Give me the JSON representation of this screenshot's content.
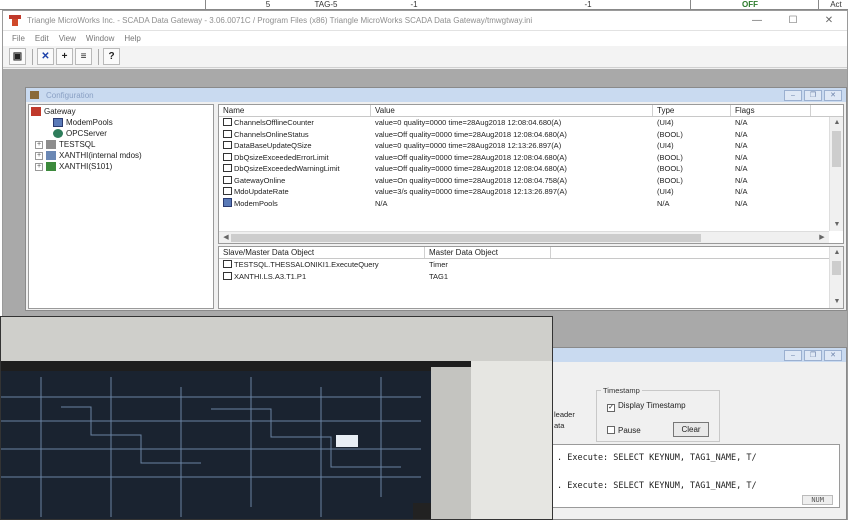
{
  "background_table": {
    "cells": [
      "5",
      "TAG-5",
      "-1",
      "-1",
      "OFF",
      "Act"
    ]
  },
  "window": {
    "title": "Triangle MicroWorks Inc. - SCADA Data Gateway - 3.06.0071C / Program Files (x86) Triangle MicroWorks SCADA Data Gateway/tmwgtway.ini",
    "controls": {
      "minimize": "—",
      "maximize": "☐",
      "close": "✕"
    }
  },
  "menu": [
    "File",
    "Edit",
    "View",
    "Window",
    "Help"
  ],
  "toolbar": {
    "buttons": [
      {
        "name": "save-icon",
        "glyph": "▣"
      },
      {
        "name": "delete-icon",
        "glyph": "✕"
      },
      {
        "name": "add-icon",
        "glyph": "+"
      },
      {
        "name": "properties-icon",
        "glyph": "≡"
      },
      {
        "name": "help-icon",
        "glyph": "?"
      }
    ]
  },
  "config_window": {
    "title": "Configuration",
    "tree": [
      {
        "label": "Gateway",
        "level": 0,
        "icon": "gateway-icon",
        "expander": ""
      },
      {
        "label": "ModemPools",
        "level": 1,
        "icon": "modem-pools-icon",
        "expander": ""
      },
      {
        "label": "OPCServer",
        "level": 1,
        "icon": "opc-server-icon",
        "expander": ""
      },
      {
        "label": "TESTSQL",
        "level": 1,
        "icon": "sql-icon",
        "expander": "+"
      },
      {
        "label": "XANTHI(internal mdos)",
        "level": 1,
        "icon": "channel-icon",
        "expander": "+"
      },
      {
        "label": "XANTHI(S101)",
        "level": 1,
        "icon": "device-icon",
        "expander": "+"
      }
    ],
    "columns": [
      "Name",
      "Value",
      "Type",
      "Flags"
    ],
    "rows": [
      {
        "name": "ChannelsOfflineCounter",
        "value": "value=0     quality=0000 time=28Aug2018 12:08:04.680(A)",
        "type": "(UI4)",
        "flags": "N/A"
      },
      {
        "name": "ChannelsOnlineStatus",
        "value": "value=Off   quality=0000 time=28Aug2018 12:08:04.680(A)",
        "type": "(BOOL)",
        "flags": "N/A"
      },
      {
        "name": "DataBaseUpdateQSize",
        "value": "value=0     quality=0000 time=28Aug2018 12:13:26.897(A)",
        "type": "(UI4)",
        "flags": "N/A"
      },
      {
        "name": "DbQsizeExceededErrorLimit",
        "value": "value=Off   quality=0000 time=28Aug2018 12:08:04.680(A)",
        "type": "(BOOL)",
        "flags": "N/A"
      },
      {
        "name": "DbQsizeExceededWarningLimit",
        "value": "value=Off   quality=0000 time=28Aug2018 12:08:04.680(A)",
        "type": "(BOOL)",
        "flags": "N/A"
      },
      {
        "name": "GatewayOnline",
        "value": "value=On    quality=0000 time=28Aug2018 12:08:04.758(A)",
        "type": "(BOOL)",
        "flags": "N/A"
      },
      {
        "name": "MdoUpdateRate",
        "value": "value=3/s quality=0000 time=28Aug2018 12:13:26.897(A)",
        "type": "(UI4)",
        "flags": "N/A"
      },
      {
        "name": "ModemPools",
        "value": "N/A",
        "type": "N/A",
        "flags": "N/A"
      }
    ],
    "mapping_columns": [
      "Slave/Master Data Object",
      "Master Data Object"
    ],
    "mapping_rows": [
      {
        "slave": "TESTSQL.THESSALONIKI1.ExecuteQuery",
        "master": "Timer"
      },
      {
        "slave": "XANTHI.LS.A3.T1.P1",
        "master": "TAG1"
      }
    ]
  },
  "analyzer_window": {
    "timestamp_group": "Timestamp",
    "display_timestamp_label": "Display Timestamp",
    "display_timestamp_checked": true,
    "pause_label": "Pause",
    "clear_label": "Clear",
    "partial_labels": [
      "leader",
      "ata"
    ],
    "log_lines": [
      ". Execute: SELECT KEYNUM, TAG1_NAME, T/",
      ". Execute: SELECT KEYNUM, TAG1_NAME, T/"
    ],
    "status": "NUM"
  }
}
